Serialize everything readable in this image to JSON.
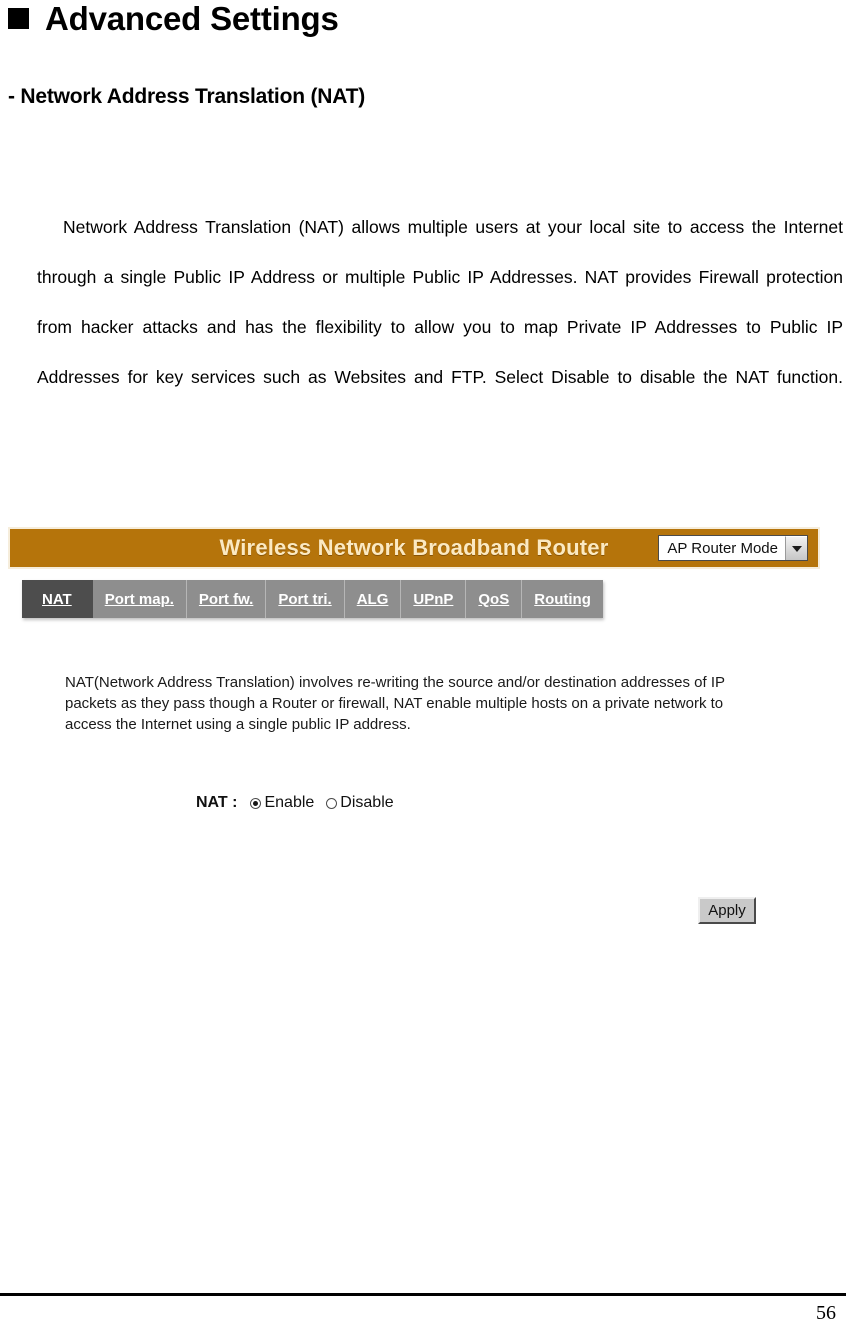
{
  "document": {
    "heading": "Advanced Settings",
    "heading_bullet_icon": "filled-square-bullet",
    "subheading": "- Network Address Translation (NAT)",
    "paragraph": "Network Address Translation (NAT) allows multiple users at your local site to access the Internet through a single Public IP Address or multiple Public IP Addresses. NAT provides Firewall protection from hacker attacks and has the flexibility to allow you to map Private IP Addresses to Public IP Addresses for key services such as Websites and FTP. Select Disable to disable the NAT function.",
    "page_number": "56"
  },
  "router_ui": {
    "brand_title": "Wireless Network Broadband Router",
    "header_color": "#b5740b",
    "brand_text_color": "#fbe9c2",
    "mode_select": {
      "selected": "AP Router Mode",
      "arrow_icon": "chevron-down-icon"
    },
    "tabs": [
      {
        "label": "NAT",
        "active": true
      },
      {
        "label": "Port map.",
        "active": false
      },
      {
        "label": "Port fw.",
        "active": false
      },
      {
        "label": "Port tri.",
        "active": false
      },
      {
        "label": "ALG",
        "active": false
      },
      {
        "label": "UPnP",
        "active": false
      },
      {
        "label": "QoS",
        "active": false
      },
      {
        "label": "Routing",
        "active": false
      }
    ],
    "active_tab_color": "#4d4d4d",
    "inactive_tab_color": "#8e8e8e",
    "description": "NAT(Network Address Translation) involves re-writing the source and/or destination addresses of IP packets as they pass though a Router or firewall, NAT enable multiple hosts on a private network to access the Internet using a single public IP address.",
    "nat_field": {
      "label": "NAT :",
      "options": [
        {
          "label": "Enable",
          "checked": true
        },
        {
          "label": "Disable",
          "checked": false
        }
      ]
    },
    "apply_label": "Apply"
  }
}
